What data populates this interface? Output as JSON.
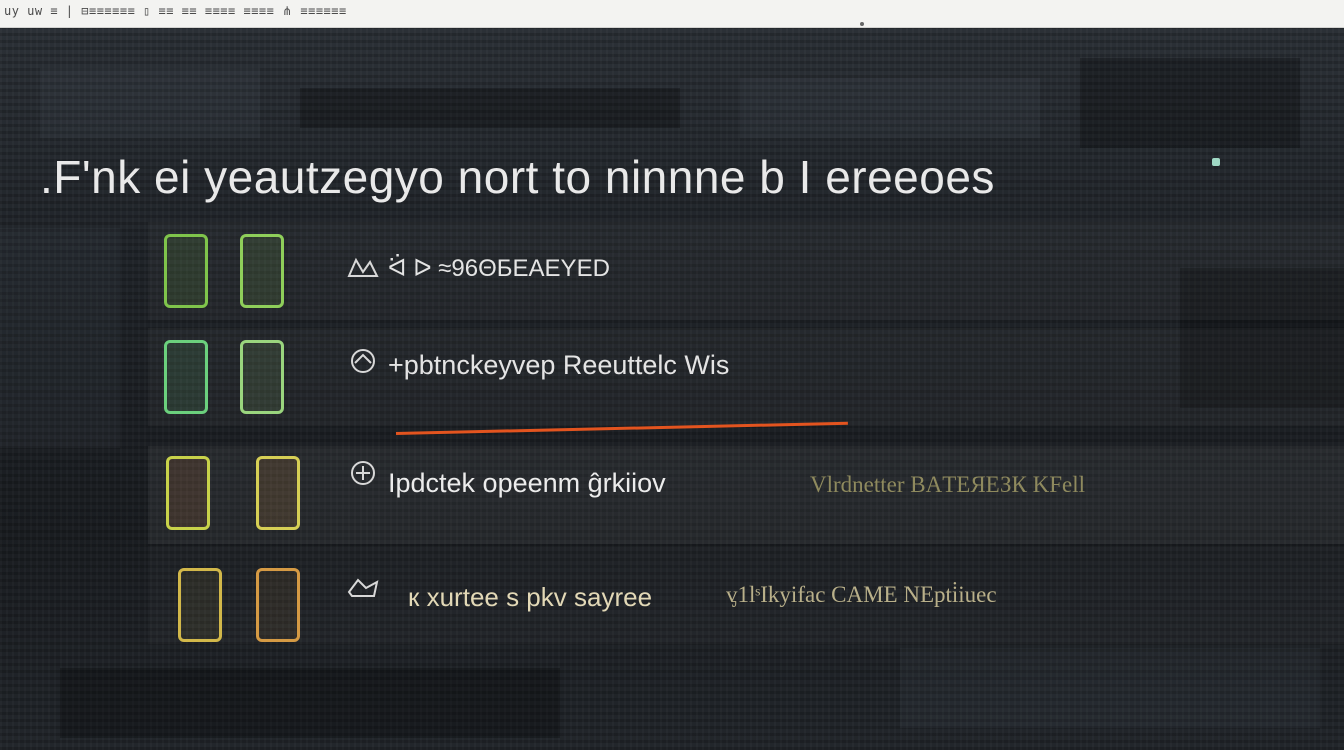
{
  "topbar": {
    "text": "uy uw ≡ | ⊟≡≡≡≡≡≡ ▯ ≡≡ ≡≡ ≡≡≡≡ ≡≡≡≡ ⋔ ≡≡≡≡≡≡"
  },
  "heading": ".F'nk ei yeautzegyo nort to ninnne b I ereeoes",
  "rows": [
    {
      "label": "ᐛ ᐅ ≈96ΘБEAEYED",
      "aside": ""
    },
    {
      "label": "+pbtnckeyvep Reeuttelc Wis",
      "aside": ""
    },
    {
      "label": "Ipdctek opeenm ĝrkiiov",
      "aside": "Vlrdnetter  ВAТЕЯЕЗК KFell"
    },
    {
      "label": "к xurtee s pkv sayree",
      "aside": "ᶌ1lˢIkyifac CAME NEpti̇iuec"
    }
  ],
  "colors": {
    "accent_underline": "#e3541f",
    "row1_key": "#7fc44b",
    "row2_key": "#6bd07d",
    "row3_key": "#c8d24a",
    "row4_key": "#d2b84a"
  }
}
